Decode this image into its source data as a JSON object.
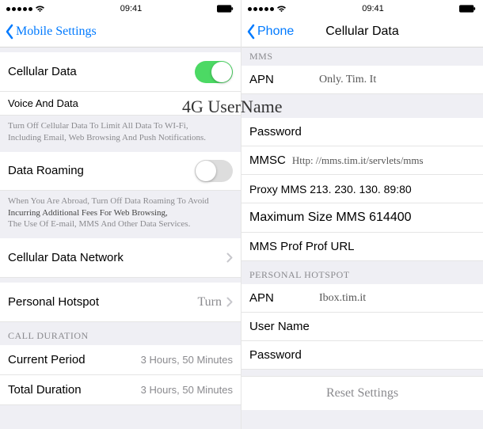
{
  "status": {
    "time": "09:41"
  },
  "left": {
    "back_label": "Mobile Settings",
    "rows": {
      "cellular_data": "Cellular Data",
      "voice_and_data": "Voice And Data",
      "data_roaming": "Data Roaming",
      "cellular_data_network": "Cellular Data Network",
      "personal_hotspot": "Personal Hotspot",
      "personal_hotspot_value": "Turn"
    },
    "desc1_a": "Turn Off Cellular Data To Limit All Data To WI-Fi,",
    "desc1_b": "Including Email, Web Browsing And Push Notifications.",
    "desc2_a": "When You Are Abroad, Turn Off Data Roaming To Avoid",
    "desc2_b": "Incurring Additional Fees For Web Browsing,",
    "desc2_c": "The Use Of E-mail, MMS And Other Data Services.",
    "call_duration_header": "CALL DURATION",
    "current_period_label": "Current Period",
    "current_period_value": "3 Hours, 50 Minutes",
    "total_duration_label": "Total Duration",
    "total_duration_value": "3 Hours, 50 Minutes",
    "big_4g": "4G UserName"
  },
  "right": {
    "back_label": "Phone",
    "title": "Cellular Data",
    "mms_header": "MMS",
    "mms": {
      "apn_label": "APN",
      "apn_value": "Only. Tim. It",
      "password_label": "Password",
      "mmsc_label": "MMSC",
      "mmsc_value": "Http: //mms.tim.it/servlets/mms",
      "proxy_label": "Proxy MMS 213. 230. 130. 89:80",
      "max_size_label": "Maximum Size MMS 614400",
      "prof_url_label": "MMS Prof Prof URL"
    },
    "hotspot_header": "PERSONAL HOTSPOT",
    "hotspot": {
      "apn_label": "APN",
      "apn_value": "Ibox.tim.it",
      "username_label": "User Name",
      "password_label": "Password"
    },
    "reset_label": "Reset Settings"
  }
}
